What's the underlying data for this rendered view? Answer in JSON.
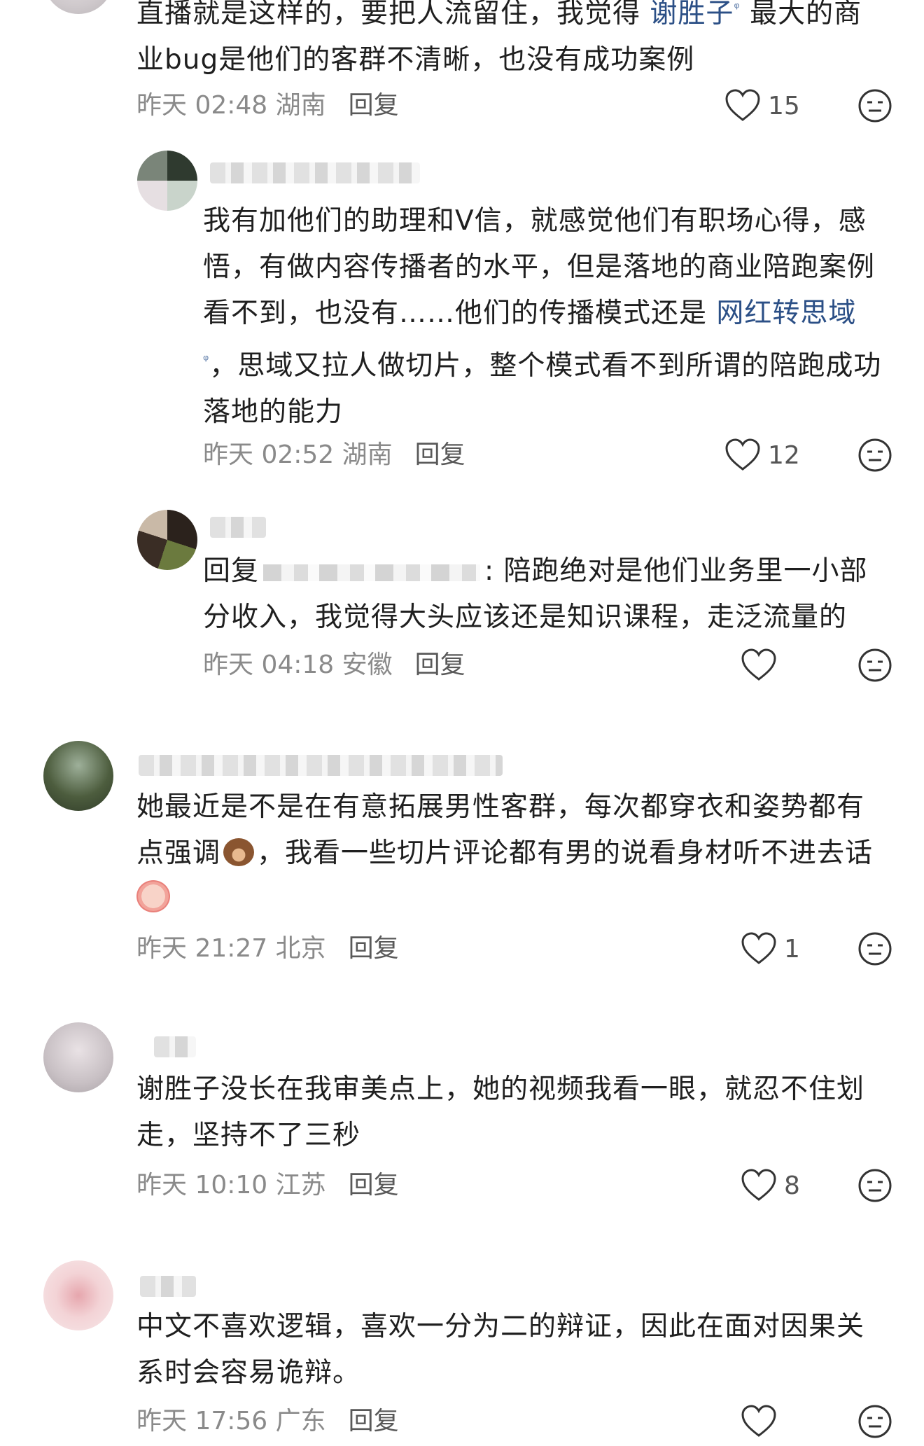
{
  "comments": [
    {
      "text_before": "直播就是这样的，要把人流留住，我觉得 ",
      "link": "谢胜子",
      "text_after": " 最大的商业bug是他们的客群不清晰，也没有成功案例",
      "time": "昨天 02:48",
      "location": "湖南",
      "reply_label": "回复",
      "likes": "15"
    },
    {
      "text_before": "我有加他们的助理和V信，就感觉他们有职场心得，感悟，有做内容传播者的水平，但是落地的商业陪跑案例看不到，也没有……他们的传播模式还是 ",
      "link": "网红转思域",
      "text_after": "，思域又拉人做切片，整个模式看不到所谓的陪跑成功落地的能力",
      "time": "昨天 02:52",
      "location": "湖南",
      "reply_label": "回复",
      "likes": "12"
    },
    {
      "reply_prefix": "回复",
      "text_after": ": 陪跑绝对是他们业务里一小部分收入，我觉得大头应该还是知识课程，走泛流量的",
      "time": "昨天 04:18",
      "location": "安徽",
      "reply_label": "回复",
      "likes": ""
    },
    {
      "text_a": "她最近是不是在有意拓展男性客群，每次都穿衣和姿势都有点强调",
      "text_b": "，我看一些切片评论都有男的说看身材听不进去话",
      "time": "昨天 21:27",
      "location": "北京",
      "reply_label": "回复",
      "likes": "1"
    },
    {
      "text": "谢胜子没长在我审美点上，她的视频我看一眼，就忍不住划走，坚持不了三秒",
      "time": "昨天 10:10",
      "location": "江苏",
      "reply_label": "回复",
      "likes": "8"
    },
    {
      "text": "中文不喜欢逻辑，喜欢一分为二的辩证，因此在面对因果关系时会容易诡辩。",
      "time": "昨天 17:56",
      "location": "广东",
      "reply_label": "回复",
      "likes": ""
    }
  ]
}
